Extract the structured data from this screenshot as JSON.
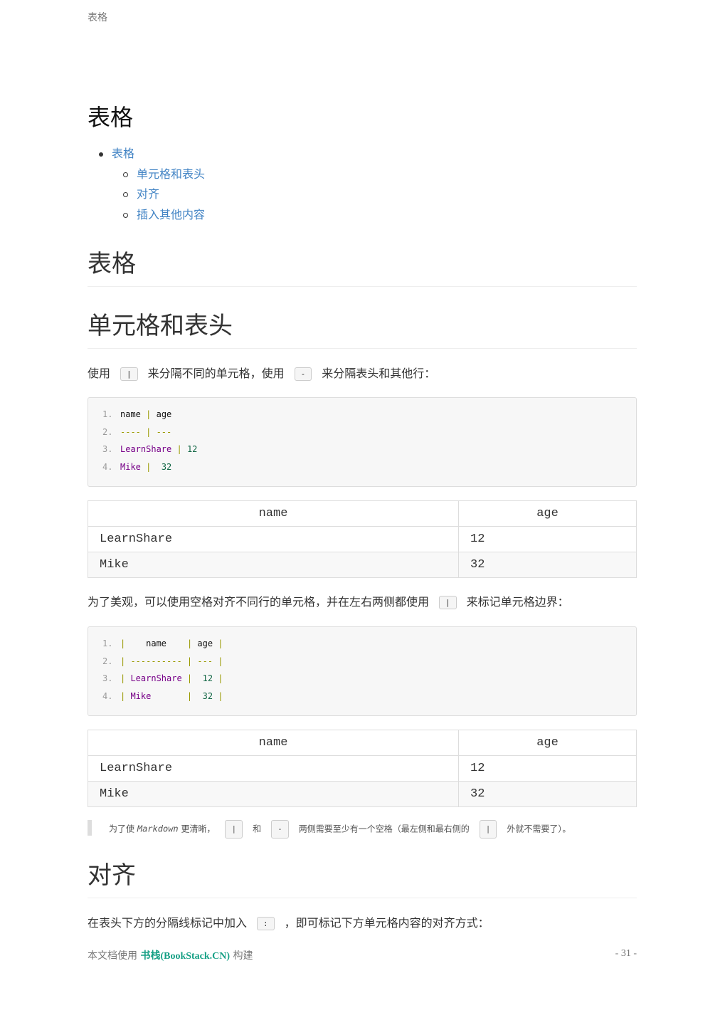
{
  "running_header": "表格",
  "title": "表格",
  "toc": {
    "top": "表格",
    "children": [
      "单元格和表头",
      "对齐",
      "插入其他内容"
    ]
  },
  "sections": {
    "s1": "表格",
    "s2": "单元格和表头",
    "s3": "对齐"
  },
  "para1": {
    "a": "使用",
    "c1": "|",
    "b": "来分隔不同的单元格，使用",
    "c2": "-",
    "c": "来分隔表头和其他行："
  },
  "code1": [
    [
      [
        "name",
        "def"
      ],
      [
        " | ",
        "sep"
      ],
      [
        "age",
        "def"
      ]
    ],
    [
      [
        "---- | ---",
        "sep"
      ]
    ],
    [
      [
        "LearnShare",
        "str"
      ],
      [
        " | ",
        "sep"
      ],
      [
        "12",
        "num"
      ]
    ],
    [
      [
        "Mike",
        "str"
      ],
      [
        " |  ",
        "sep"
      ],
      [
        "32",
        "num"
      ]
    ]
  ],
  "table1": {
    "headers": [
      "name",
      "age"
    ],
    "rows": [
      [
        "LearnShare",
        "12"
      ],
      [
        "Mike",
        "32"
      ]
    ]
  },
  "para2": {
    "a": "为了美观，可以使用空格对齐不同行的单元格，并在左右两侧都使用",
    "c1": "|",
    "b": "来标记单元格边界："
  },
  "code2": [
    [
      [
        "| ",
        "sep"
      ],
      [
        "   name    ",
        "def"
      ],
      [
        "| ",
        "sep"
      ],
      [
        "age",
        "def"
      ],
      [
        " |",
        "sep"
      ]
    ],
    [
      [
        "| ---------- | --- |",
        "sep"
      ]
    ],
    [
      [
        "| ",
        "sep"
      ],
      [
        "LearnShare",
        "str"
      ],
      [
        " |  ",
        "sep"
      ],
      [
        "12",
        "num"
      ],
      [
        " |",
        "sep"
      ]
    ],
    [
      [
        "| ",
        "sep"
      ],
      [
        "Mike      ",
        "str"
      ],
      [
        " |  ",
        "sep"
      ],
      [
        "32",
        "num"
      ],
      [
        " |",
        "sep"
      ]
    ]
  ],
  "table2": {
    "headers": [
      "name",
      "age"
    ],
    "rows": [
      [
        "LearnShare",
        "12"
      ],
      [
        "Mike",
        "32"
      ]
    ]
  },
  "note": {
    "a": "为了使",
    "md": "Markdown",
    "b": "更清晰，",
    "c1": "|",
    "and": "和",
    "c2": "-",
    "c": "两侧需要至少有一个空格（最左侧和最右侧的",
    "c3": "|",
    "d": "外就不需要了）。"
  },
  "para3": {
    "a": "在表头下方的分隔线标记中加入",
    "c1": ":",
    "b": "，即可标记下方单元格内容的对齐方式："
  },
  "footer": {
    "pre": "本文档使用",
    "brand": "书栈(BookStack.CN)",
    "post": "构建",
    "page": "- 31 -"
  }
}
